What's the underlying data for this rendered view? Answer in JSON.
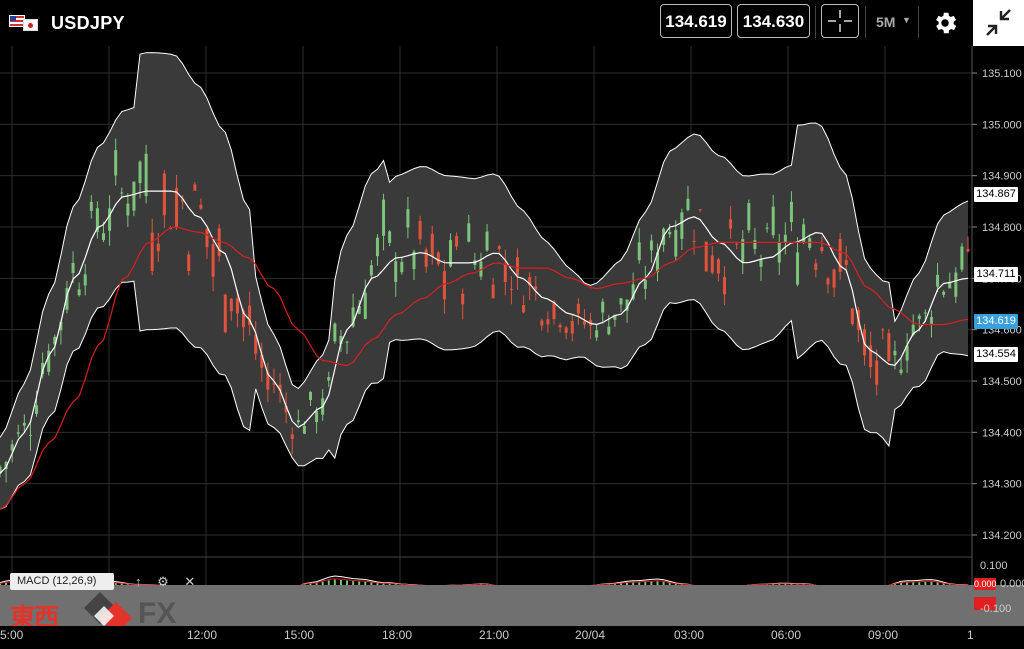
{
  "header": {
    "symbol": "USDJPY",
    "bid": "134.619",
    "ask": "134.630",
    "timeframe": "5M"
  },
  "price_axis": {
    "ticks": [
      "135.100",
      "135.000",
      "134.900",
      "134.800",
      "134.700",
      "134.600",
      "134.500",
      "134.400",
      "134.300",
      "134.200"
    ],
    "labels": {
      "upper_band": "134.867",
      "mid_band": "134.711",
      "last": "134.619",
      "lower_band": "134.554"
    }
  },
  "macd": {
    "label": "MACD (12,26,9)",
    "ticks": [
      "0.100",
      "0.000",
      "-0.100"
    ],
    "zero_label": "0.000"
  },
  "logo": {
    "kanji": "東西",
    "fx": "FX"
  },
  "time_axis": [
    "5:00",
    "12:00",
    "15:00",
    "18:00",
    "21:00",
    "20/04",
    "03:00",
    "06:00",
    "09:00",
    "1"
  ],
  "colors": {
    "bull_candle": "#7cc47a",
    "bear_candle": "#e2533b",
    "sma_line": "#d92020",
    "band_line": "#ffffff",
    "band_fill": "#3a3a3a",
    "last_price": "#3aa0dc"
  },
  "chart_data": {
    "type": "candlestick",
    "ylim": [
      134.2,
      135.1
    ],
    "series": [
      {
        "name": "",
        "kind": "bollinger_mid",
        "values": [
          134.32,
          134.4,
          134.55,
          134.7,
          134.8,
          134.86,
          134.87,
          134.87,
          134.82,
          134.75,
          134.62,
          134.5,
          134.41,
          134.45,
          134.6,
          134.7,
          134.74,
          134.75,
          134.73,
          134.73,
          134.75,
          134.7,
          134.66,
          134.63,
          134.61,
          134.63,
          134.7,
          134.8,
          134.82,
          134.77,
          134.73,
          134.74,
          134.77,
          134.79,
          134.72,
          134.56,
          134.53,
          134.6,
          134.69,
          134.7
        ]
      },
      {
        "name": "",
        "kind": "moving_average",
        "values": [
          134.25,
          134.3,
          134.38,
          134.46,
          134.57,
          134.7,
          134.77,
          134.8,
          134.79,
          134.77,
          134.74,
          134.68,
          134.6,
          134.54,
          134.53,
          134.58,
          134.63,
          134.66,
          134.69,
          134.71,
          134.73,
          134.72,
          134.72,
          134.7,
          134.68,
          134.69,
          134.7,
          134.73,
          134.76,
          134.77,
          134.77,
          134.77,
          134.77,
          134.77,
          134.75,
          134.68,
          134.64,
          134.61,
          134.61,
          134.62
        ]
      }
    ]
  }
}
